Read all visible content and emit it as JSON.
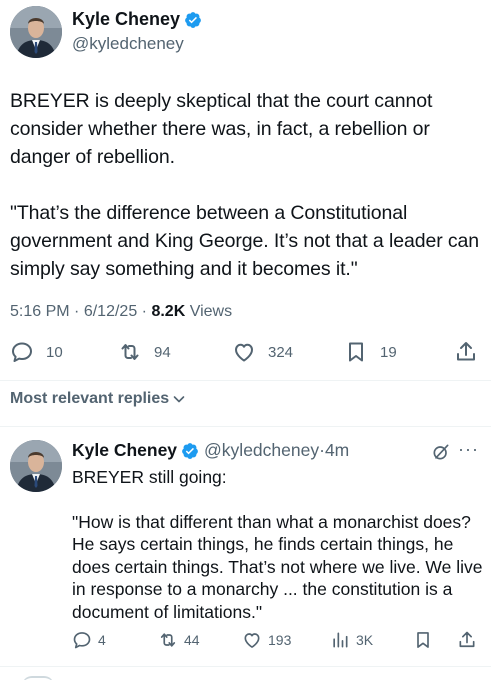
{
  "main_tweet": {
    "author_name": "Kyle Cheney",
    "handle": "@kyledcheney",
    "paragraphs": [
      "BREYER is deeply skeptical that the court cannot consider whether there was, in fact, a rebellion or danger of rebellion.",
      "\"That’s the difference between a Constitutional government and King George. It’s not that a leader can simply say something and it becomes it.\""
    ],
    "time": "5:16 PM",
    "date": "6/12/25",
    "separator": "·",
    "views_count": "8.2K",
    "views_label": "Views",
    "actions": {
      "replies": "10",
      "reposts": "94",
      "likes": "324",
      "bookmarks": "19"
    }
  },
  "replies_filter": {
    "label": "Most relevant replies"
  },
  "reply": {
    "author_name": "Kyle Cheney",
    "handle": "@kyledcheney",
    "separator": "·",
    "time": "4m",
    "more": "···",
    "paragraphs": [
      "BREYER still going:",
      "\"How is that different than what a monarchist does? He says certain things, he finds certain things, he does certain things. That’s not where we live. We live in response to a monarchy ... the constitution is a document of limitations.\""
    ],
    "actions": {
      "replies": "4",
      "reposts": "44",
      "likes": "193",
      "views": "3K"
    }
  },
  "colors": {
    "text_primary": "#0f1419",
    "text_secondary": "#536471",
    "verified_blue": "#1d9bf0",
    "divider": "#eff3f4"
  }
}
